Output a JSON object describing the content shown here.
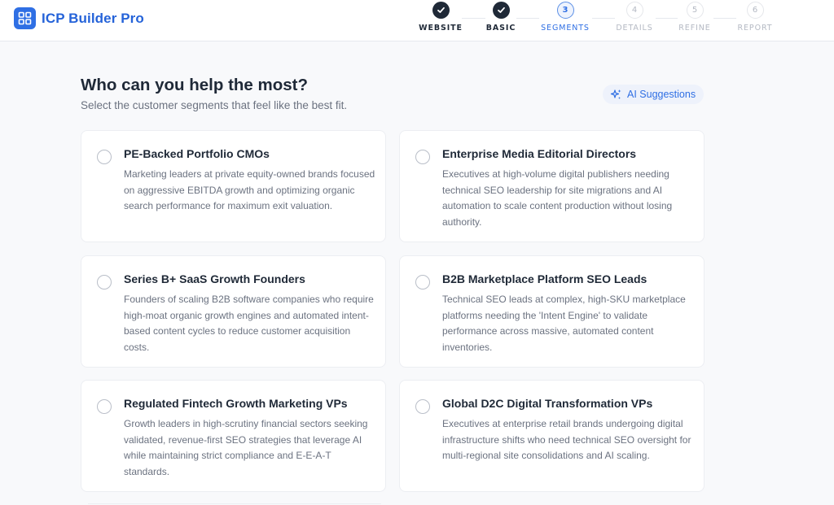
{
  "app": {
    "name": "ICP Builder Pro"
  },
  "stepper": {
    "steps": [
      {
        "number": "1",
        "label": "WEBSITE",
        "status": "done"
      },
      {
        "number": "2",
        "label": "BASIC",
        "status": "done"
      },
      {
        "number": "3",
        "label": "SEGMENTS",
        "status": "active"
      },
      {
        "number": "4",
        "label": "DETAILS",
        "status": "todo"
      },
      {
        "number": "5",
        "label": "REFINE",
        "status": "todo"
      },
      {
        "number": "6",
        "label": "REPORT",
        "status": "todo"
      }
    ]
  },
  "main": {
    "title": "Who can you help the most?",
    "subtitle": "Select the customer segments that feel like the best fit.",
    "ai_button": {
      "label": "AI Suggestions",
      "icon": "sparkles-icon"
    }
  },
  "segments": [
    {
      "title": "PE-Backed Portfolio CMOs",
      "description": "Marketing leaders at private equity-owned brands focused on aggressive EBITDA growth and optimizing organic search performance for maximum exit valuation.",
      "selected": false
    },
    {
      "title": "Enterprise Media Editorial Directors",
      "description": "Executives at high-volume digital publishers needing technical SEO leadership for site migrations and AI automation to scale content production without losing authority.",
      "selected": false
    },
    {
      "title": "Series B+ SaaS Growth Founders",
      "description": "Founders of scaling B2B software companies who require high-moat organic growth engines and automated intent-based content cycles to reduce customer acquisition costs.",
      "selected": false
    },
    {
      "title": "B2B Marketplace Platform SEO Leads",
      "description": "Technical SEO leads at complex, high-SKU marketplace platforms needing the 'Intent Engine' to validate performance across massive, automated content inventories.",
      "selected": false
    },
    {
      "title": "Regulated Fintech Growth Marketing VPs",
      "description": "Growth leaders in high-scrutiny financial sectors seeking validated, revenue-first SEO strategies that leverage AI while maintaining strict compliance and E-E-A-T standards.",
      "selected": false
    },
    {
      "title": "Global D2C Digital Transformation VPs",
      "description": "Executives at enterprise retail brands undergoing digital infrastructure shifts who need technical SEO oversight for multi-regional site consolidations and AI scaling.",
      "selected": false
    }
  ],
  "colors": {
    "brand": "#2f6fe4",
    "done_step": "#1f2937",
    "muted": "#b4b9c3"
  }
}
